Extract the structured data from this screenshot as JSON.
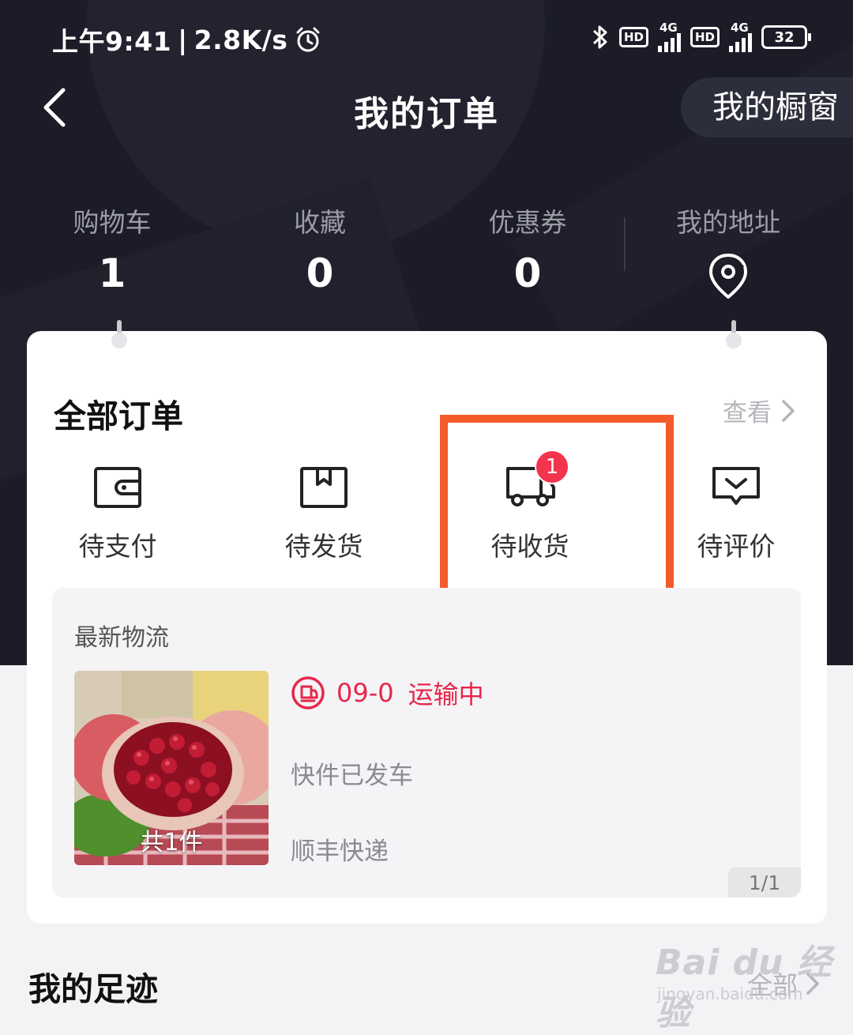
{
  "status_bar": {
    "time": "上午9:41",
    "speed": "2.8K/s",
    "hd1": "HD",
    "net1": "4G",
    "hd2": "HD",
    "net2": "4G",
    "battery": "32"
  },
  "header": {
    "title": "我的订单",
    "back_icon": "back-arrow-icon",
    "showcase_label": "我的橱窗"
  },
  "stats": [
    {
      "label": "购物车",
      "value": "1"
    },
    {
      "label": "收藏",
      "value": "0"
    },
    {
      "label": "优惠券",
      "value": "0"
    },
    {
      "label": "我的地址",
      "icon": "location-pin-icon"
    }
  ],
  "orders": {
    "title": "全部订单",
    "view_label": "查看",
    "tabs": [
      {
        "label": "待支付",
        "icon": "wallet-icon"
      },
      {
        "label": "待发货",
        "icon": "package-box-icon"
      },
      {
        "label": "待收货",
        "icon": "delivery-truck-icon",
        "badge": "1"
      },
      {
        "label": "待评价",
        "icon": "comment-icon"
      }
    ],
    "highlight_color": "#f45b2a"
  },
  "logistics": {
    "title": "最新物流",
    "item_count": "共1件",
    "tracking_code": "09-0",
    "status": "运输中",
    "description": "快件已发车",
    "carrier": "顺丰快递",
    "page": "1/1",
    "accent_color": "#e8264b"
  },
  "footprint": {
    "title": "我的足迹",
    "all_label": "全部"
  },
  "watermark": {
    "brand": "Bai du 经验",
    "url": "jingyan.baidu.com"
  }
}
